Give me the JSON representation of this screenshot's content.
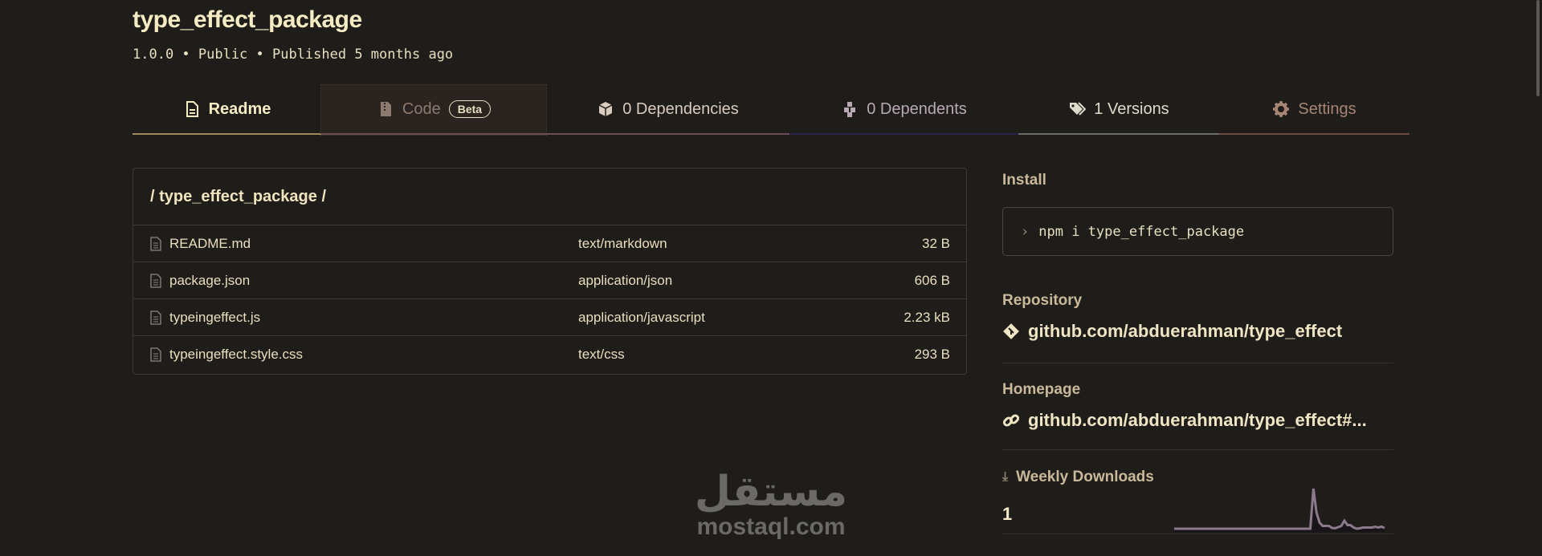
{
  "package": {
    "name": "type_effect_package",
    "meta": "1.0.0 • Public • Published 5 months ago"
  },
  "tabs": [
    {
      "label": "Readme",
      "icon": "file-icon",
      "color": "#f6ecc4",
      "underline": "#9b8a5a"
    },
    {
      "label": "Code",
      "badge": "Beta",
      "icon": "zip-file-icon",
      "color": "#8c7a6e",
      "underline": "#6b4e4e"
    },
    {
      "label": "0 Dependencies",
      "icon": "box-icon",
      "color": "#d9cbbd",
      "underline": "#6b4e55"
    },
    {
      "label": "0 Dependents",
      "icon": "boxes-icon",
      "color": "#b9a9b5",
      "underline": "#27224a"
    },
    {
      "label": "1 Versions",
      "icon": "tags-icon",
      "color": "#dcdccc",
      "underline": "#6c6c66"
    },
    {
      "label": "Settings",
      "icon": "gear-icon",
      "color": "#a68574",
      "underline": "#6b4a40"
    }
  ],
  "files": {
    "path": "/ type_effect_package /",
    "rows": [
      {
        "name": "README.md",
        "type": "text/markdown",
        "size": "32 B"
      },
      {
        "name": "package.json",
        "type": "application/json",
        "size": "606 B"
      },
      {
        "name": "typeingeffect.js",
        "type": "application/javascript",
        "size": "2.23 kB"
      },
      {
        "name": "typeingeffect.style.css",
        "type": "text/css",
        "size": "293 B"
      }
    ]
  },
  "sidebar": {
    "install_label": "Install",
    "install_cmd": "npm i type_effect_package",
    "repo_label": "Repository",
    "repo_link": "github.com/abduerahman/type_effect",
    "home_label": "Homepage",
    "home_link": "github.com/abduerahman/type_effect#...",
    "downloads_label": "Weekly Downloads",
    "downloads_value": "1",
    "downloads_series": [
      0,
      0,
      0,
      0,
      0,
      0,
      0,
      0,
      0,
      0,
      0,
      0,
      0,
      0,
      0,
      0,
      0,
      0,
      0,
      0,
      0,
      0,
      0,
      0,
      0,
      0,
      0,
      0,
      0,
      0,
      0,
      0,
      0,
      0,
      0,
      0,
      0,
      0,
      0,
      0,
      0,
      0,
      0,
      0,
      0,
      10,
      4,
      1.5,
      0.7,
      0.7,
      0.7,
      0.2,
      0.1,
      0.4,
      0.7,
      2,
      0.9,
      0.9,
      0.3,
      0,
      0.1,
      0.3,
      0.3,
      0.3,
      0.3,
      0.5,
      0.3,
      0.5,
      0.2
    ]
  },
  "watermark": {
    "arabic": "مستقل",
    "latin": "mostaql.com"
  }
}
